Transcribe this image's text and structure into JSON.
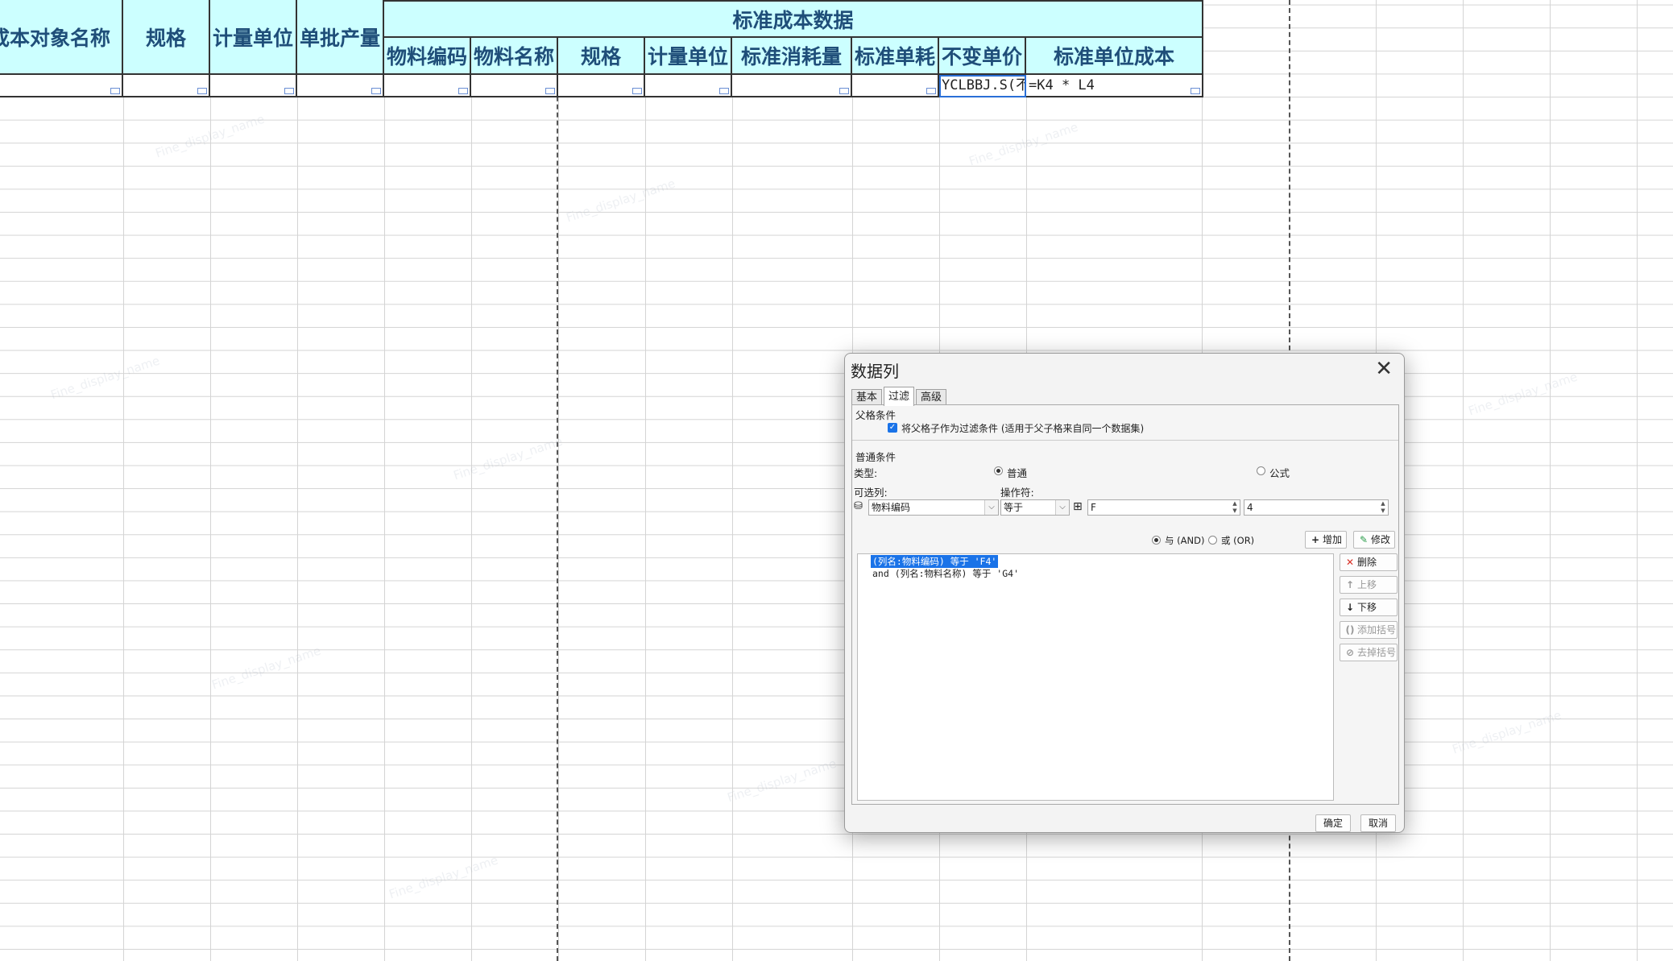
{
  "sheet": {
    "header_row1_left": [
      "成本对象名称",
      "规格",
      "计量单位",
      "单批产量"
    ],
    "header_group": "标准成本数据",
    "header_row2": [
      "物料编码",
      "物料名称",
      "规格",
      "计量单位",
      "标准消耗量",
      "标准单耗",
      "不变单价",
      "标准单位成本"
    ],
    "row4": {
      "unit_price_formula": "YCLBBJ.S(不",
      "unit_cost_formula": "=K4 * L4"
    }
  },
  "dialog": {
    "title": "数据列",
    "tabs": [
      "基本",
      "过滤",
      "高级"
    ],
    "active_tab": 1,
    "parent_section": {
      "title": "父格条件",
      "checkbox_label": "将父格子作为过滤条件 (适用于父子格来自同一个数据集)",
      "checked": true
    },
    "normal_section": {
      "title": "普通条件",
      "type_label": "类型:",
      "type_options": [
        "普通",
        "公式"
      ],
      "type_selected": 0,
      "column_label": "可选列:",
      "operator_label": "操作符:",
      "column_value": "物料编码",
      "operator_value": "等于",
      "value1": "F",
      "value2": "4"
    },
    "logic": {
      "and_label": "与 (AND)",
      "or_label": "或 (OR)",
      "selected": 0
    },
    "buttons": {
      "add": "增加",
      "modify": "修改",
      "delete": "删除",
      "up": "上移",
      "down": "下移",
      "add_paren": "添加括号",
      "remove_paren": "去掉括号",
      "ok": "确定",
      "cancel": "取消"
    },
    "conditions": [
      "(列名:物料编码) 等于 'F4'",
      "and (列名:物料名称) 等于 'G4'"
    ]
  }
}
